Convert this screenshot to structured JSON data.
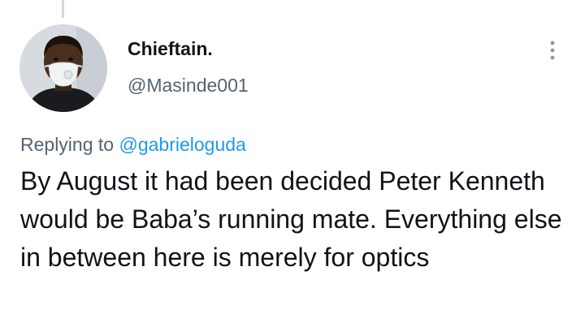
{
  "author": {
    "display_name": "Chieftain.",
    "handle": "@Masinde001",
    "avatar_icon": "user-avatar-with-face-mask"
  },
  "menu": {
    "icon": "more-options-icon"
  },
  "reply": {
    "prefix": "Replying to",
    "mention": "@gabrieloguda"
  },
  "tweet": {
    "text": "By August it had been decided Peter Kenneth would be Baba’s running mate. Everything else in between here is merely for optics"
  },
  "colors": {
    "link": "#1d9bf0",
    "secondary_text": "#536471",
    "primary_text": "#0f1419"
  }
}
